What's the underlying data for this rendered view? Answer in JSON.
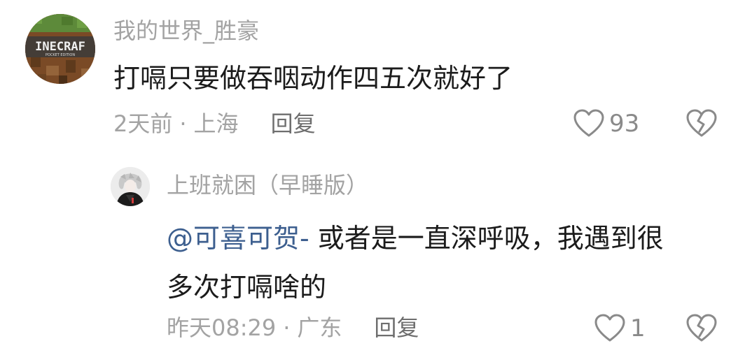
{
  "comment": {
    "username": "我的世界_胜豪",
    "avatar_text": "INECRAF",
    "avatar_subtext": "POCKET EDITION",
    "text": "打嗝只要做吞咽动作四五次就好了",
    "time": "2天前",
    "separator": "·",
    "location": "上海",
    "reply_label": "回复",
    "like_count": "93",
    "like_icon": "heart-outline-icon",
    "dislike_icon": "broken-heart-icon"
  },
  "reply": {
    "username": "上班就困（早睡版）",
    "mention": "@可喜可贺-",
    "text_line1": " 或者是一直深呼吸，我遇到很",
    "text_line2": "多次打嗝啥的",
    "time": "昨天08:29",
    "separator": "·",
    "location": "广东",
    "reply_label": "回复",
    "like_count": "1",
    "like_icon": "heart-outline-icon",
    "dislike_icon": "broken-heart-icon"
  },
  "colors": {
    "meta_gray": "#a3a3a3",
    "text_dark": "#1b1b1b",
    "mention_blue": "#3d5f8f",
    "icon_gray": "#8a8a8a"
  }
}
